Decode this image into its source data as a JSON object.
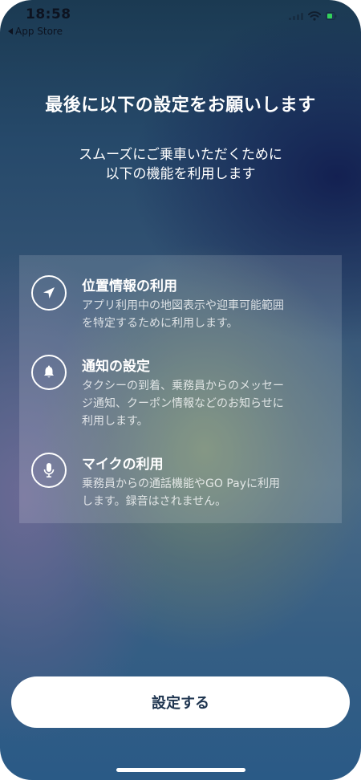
{
  "status_bar": {
    "time": "18:58",
    "back_label": "App Store"
  },
  "header": {
    "title": "最後に以下の設定をお願いします",
    "subtitle_lines": [
      "スムーズにご乗車いただくために",
      "以下の機能を利用します"
    ]
  },
  "features": [
    {
      "icon": "location-arrow-icon",
      "title": "位置情報の利用",
      "description_lines": [
        "アプリ利用中の地図表示や迎車可能範囲",
        "を特定するために利用します。"
      ]
    },
    {
      "icon": "bell-icon",
      "title": "通知の設定",
      "description_lines": [
        "タクシーの到着、乗務員からのメッセー",
        "ジ通知、クーポン情報などのお知らせに",
        "利用します。"
      ]
    },
    {
      "icon": "microphone-icon",
      "title": "マイクの利用",
      "description_lines": [
        "乗務員からの通話機能やGO Payに利用",
        "します。録音はされません。"
      ]
    }
  ],
  "primary_button": {
    "label": "設定する"
  },
  "colors": {
    "button_text": "#1f3550",
    "battery": "#33d25a"
  }
}
